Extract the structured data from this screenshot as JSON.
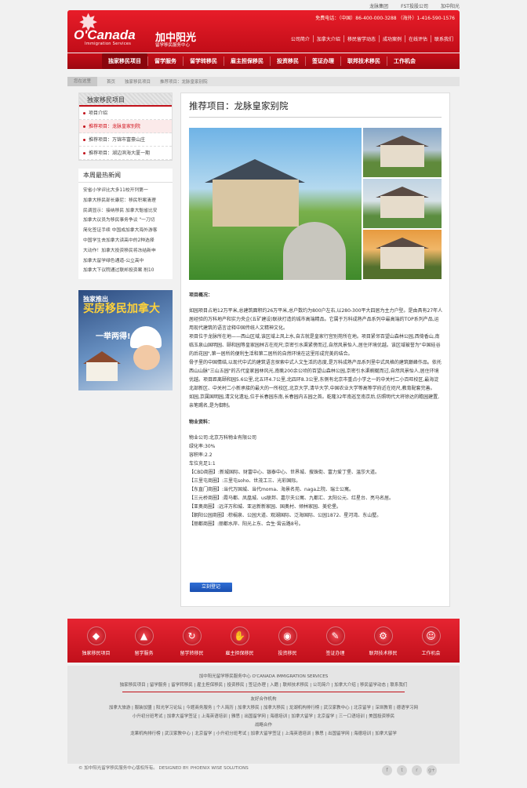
{
  "top_links": [
    "龙脉集团",
    "FST投股公司",
    "加中阳光"
  ],
  "header": {
    "logo_en": "O'Canada",
    "logo_en_sub": "Immigration Services",
    "logo_cn": "加中阳光",
    "logo_cn_sub": "留学移民服务中心",
    "phone": "免费电话：（中国）86-400-000-3288 （海外）1-416-590-1576",
    "subnav": [
      "公司简介",
      "加拿大介绍",
      "移民留学动态",
      "成功案例",
      "在线评估",
      "联系我们"
    ]
  },
  "main_nav": [
    "独家移民项目",
    "留学服务",
    "留学转移民",
    "雇主担保移民",
    "投资移民",
    "签证办理",
    "联邦技术移民",
    "工作机会"
  ],
  "breadcrumb": {
    "here": "您在这里",
    "items": [
      "首页",
      "独家移民项目",
      "推荐项目：龙脉皇家别院"
    ]
  },
  "sidebar": {
    "title": "独家移民项目",
    "items": [
      "项目介绍",
      "推荐项目：龙脉皇家别院",
      "推荐项目：万锦市富豪山庄",
      "推荐项目：湖边滨海大厦一期"
    ],
    "news_title": "本周最热新闻",
    "news": [
      "安省小学评比大多11校开列第一",
      "加拿大移民部长康尼：移民积案清理",
      "民调显示：接纳移民 加拿大魁省比安",
      "加拿大议员为移民事务争议 \"一刀切",
      "简化签证手续 中国成加拿大海外游客",
      "中国学生去加拿大读高中的2种选择",
      "大动作！加拿大投资移民将冻结新申",
      "加拿大留学绿色通道-公立高中",
      "加拿大下议院通过联邦投资案 削10"
    ],
    "promo": {
      "line1": "独家推出",
      "line2": "买房移民加拿大",
      "line3": "一举两得!"
    }
  },
  "content": {
    "title": "推荐项目：龙脉皇家别院",
    "overview_label": "项目概况：",
    "overview_paragraphs": [
      "如园项目占地12万平米,总建筑面积约26万平米,总户数约为800户左右,以280-300平大四居为主力户型。是由具有27年人居经验的万科地产和实力央企(五矿建设)联袂打造的城市高端精品。它属于万科成熟产品系列中最高端的TOP系列产品,运用现代建筑的语言诠释中国传统人文精神文化。",
      "项目位于龙脉所在地——西山区域,该区域上风上水,自古就是皇家行宫别苑所在地。项目紧邻百望山森林公园,西倚香山,南临玉泉山国明园、颐和园等皇家园林古在咫尺;京密引水渠紧傍而过,自然风景怡人,居住环境优越。该区域被誉为\"中国硅谷的后花园\",第一居所的便利生活和第二居所的自然环境在这里形成完美的结合。",
      "骨子里的中国情结,以现代中式的建筑语言探索中式人文生活的态度,是万科成熟产品系列里中式风格的建筑巅峰作品。依托西山山脉\"三山五园\"的古代皇家园林风光,南眺200余公顷的百望山森林公园,京密引水渠蜿蜒而过,自然风景怡人,居住环境优越。项目距离颐和园5.6公里,北五环4.7公里,北四环8.3公里,东侧有北京市重点小学之一的中关村二小百旺校区,最海淀北部新区、中关村二小新承接的最大的一所校区,北京大学,清华大学,中国农业大学等高等学府近在咫尺,教育配套完善。",
      "如园,京属国明园,清文化遗址,位于长春园东南,长春园内五园之首。乾隆32年南巡至南京后,仿照明代大将徐达的瞻园建置,亲笔赐名,是为御制。"
    ],
    "property_label": "物业资料：",
    "property_lines": [
      "物业公司:北京万科物业有限公司",
      "绿化率:30%",
      "容积率:2.2",
      "车位充足1:1",
      "【CBD商圈】:新城国际、财富中心、银泰中心、世界城、搜珠街、富力爱丁堡、温莎大道。",
      "【三里屯商圈】:三里屯soho、世茂工三、光彩国际。",
      "【东直门商圈】:当代万国城、当代moma、海景名苑、naga上院、瑞士公寓。",
      "【三元桥商圈】:霞马都、凤凰城、us联邦、嘉尔夫公寓、九都汇、太阳公元、红星台、亮马名居。",
      "【亚奥商圈】:远洋万和城、亚运新新家园、国奥村、倾林家园、美伦堡。",
      "【朝阳公园商圈】:棕榈泉、公园大道、观湖国际、泛海国际、公园1872、星河湾、东山墅。",
      "【丽都商圈】:丽都水岸、阳光上东、合生·霄云路8号。"
    ],
    "register_button": "立刻登记"
  },
  "footer_bar": [
    {
      "label": "独家移民项目",
      "icon": "diamond-icon"
    },
    {
      "label": "留学服务",
      "icon": "cap-icon"
    },
    {
      "label": "留学转移民",
      "icon": "refresh-icon"
    },
    {
      "label": "雇主担保移民",
      "icon": "handshake-icon"
    },
    {
      "label": "投资移民",
      "icon": "globe-icon"
    },
    {
      "label": "签证办理",
      "icon": "stamp-icon"
    },
    {
      "label": "联邦技术移民",
      "icon": "gear-icon"
    },
    {
      "label": "工作机会",
      "icon": "person-icon"
    }
  ],
  "footer_info": {
    "org": "加中阳光留学移民服务中心  O'CANADA IMMIGRATION SERVICES",
    "links": "独家移民项目 | 留学服务 | 留学转移民 | 雇主担保移民 | 投资移民 | 签证办理 | 入籍 | 联邦技术移民 | 公司简介 | 加拿大介绍 | 移民留学动态 | 联系我们",
    "partner_title": "友好合作机构",
    "partners1": "加拿大旅游 | 服装加盟 | 阳光学习论坛 | 今题商务服务 | 个人简历 | 加拿大移民 | 加拿大移民 | 龙湖机构排行榜 | 武汉家教中心 | 北京留学 | 深圳教育 | 德语学习网",
    "partners2": "小升初分班考试 | 加拿大留学签证 | 上海英语培训 | 雅思 | 出国留学网 | 海德培训 | 加拿大留学 | 北京留学 | 三一口语培训 | 美国投资移民",
    "friend_title": "战略合作",
    "partners3": "龙果机构排行榜 | 武汉家教中心 | 北京留学 | 小升初分班考试 | 加拿大留学签证 | 上海英语培训 | 雅思 | 出国留学网 | 海德培训 | 加拿大留学"
  },
  "copyright": "© 加中阳光留学移民服务中心版权所有。    DESIGNED BY: PHOENIX WISE SOLUTIONS",
  "social": [
    {
      "icon": "facebook-icon",
      "glyph": "f"
    },
    {
      "icon": "twitter-icon",
      "glyph": "t"
    },
    {
      "icon": "rss-icon",
      "glyph": "r"
    },
    {
      "icon": "googleplus-icon",
      "glyph": "g+"
    }
  ]
}
